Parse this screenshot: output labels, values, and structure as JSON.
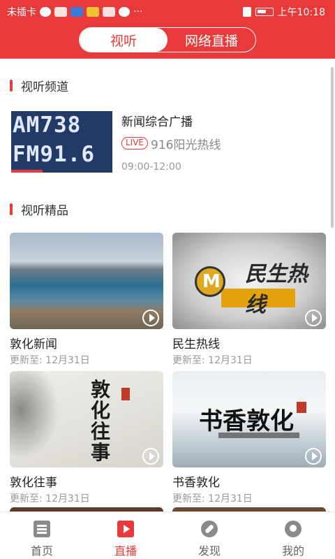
{
  "status_bar": {
    "carrier": "未插卡",
    "time": "上午10:18",
    "more": "···"
  },
  "header": {
    "tabs": [
      {
        "label": "视听",
        "active": true
      },
      {
        "label": "网络直播",
        "active": false
      }
    ]
  },
  "channels_section": {
    "title": "视听频道",
    "item": {
      "thumb_line1": "AM738",
      "thumb_line2": "FM91.6",
      "name": "新闻综合广播",
      "live_badge": "LIVE",
      "program": "916阳光热线",
      "time": "09:00-12:00"
    }
  },
  "featured_section": {
    "title": "视听精品",
    "cards": [
      {
        "title": "敦化新闻",
        "updated": "更新至: 12月31日"
      },
      {
        "title": "民生热线",
        "updated": "更新至: 12月31日",
        "thumb_text": "民生热线"
      },
      {
        "title": "敦化往事",
        "updated": "更新至: 12月31日",
        "thumb_text": "敦化往事"
      },
      {
        "title": "书香敦化",
        "updated": "更新至: 12月31日",
        "thumb_text": "书香敦化"
      }
    ]
  },
  "tab_bar": {
    "tabs": [
      {
        "label": "首页",
        "icon": "home-icon",
        "active": false
      },
      {
        "label": "直播",
        "icon": "video-play-icon",
        "active": true
      },
      {
        "label": "发现",
        "icon": "compass-icon",
        "active": false
      },
      {
        "label": "我的",
        "icon": "user-icon",
        "active": false
      }
    ]
  },
  "colors": {
    "accent": "#e83a3a"
  }
}
